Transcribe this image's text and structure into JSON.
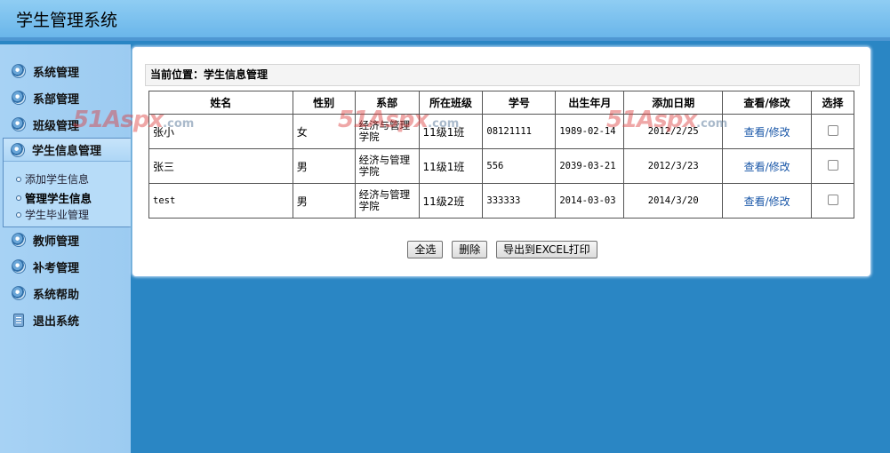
{
  "app": {
    "title": "学生管理系统"
  },
  "sidebar": {
    "items": [
      {
        "label": "系统管理",
        "icon": "disc-icon"
      },
      {
        "label": "系部管理",
        "icon": "disc-icon"
      },
      {
        "label": "班级管理",
        "icon": "disc-icon"
      },
      {
        "label": "学生信息管理",
        "icon": "disc-icon"
      },
      {
        "label": "教师管理",
        "icon": "disc-icon"
      },
      {
        "label": "补考管理",
        "icon": "disc-icon"
      },
      {
        "label": "系统帮助",
        "icon": "disc-icon"
      },
      {
        "label": "退出系统",
        "icon": "phone-icon"
      }
    ],
    "submenu": [
      {
        "label": "添加学生信息"
      },
      {
        "label": "管理学生信息"
      },
      {
        "label": "学生毕业管理"
      }
    ]
  },
  "breadcrumb": {
    "text": "当前位置：学生信息管理"
  },
  "table": {
    "headers": [
      "姓名",
      "性别",
      "系部",
      "所在班级",
      "学号",
      "出生年月",
      "添加日期",
      "查看/修改",
      "选择"
    ],
    "rows": [
      {
        "name": "张小",
        "gender": "女",
        "dept": "经济与管理学院",
        "class": "11级1班",
        "id": "08121111",
        "birth": "1989-02-14",
        "added": "2012/2/25",
        "action": "查看/修改"
      },
      {
        "name": "张三",
        "gender": "男",
        "dept": "经济与管理学院",
        "class": "11级1班",
        "id": "556",
        "birth": "2039-03-21",
        "added": "2012/3/23",
        "action": "查看/修改"
      },
      {
        "name": "test",
        "gender": "男",
        "dept": "经济与管理学院",
        "class": "11级2班",
        "id": "333333",
        "birth": "2014-03-03",
        "added": "2014/3/20",
        "action": "查看/修改"
      }
    ]
  },
  "buttons": {
    "select_all": "全选",
    "delete": "删除",
    "export": "导出到EXCEL打印"
  },
  "watermark": {
    "brand": "51Aspx",
    "domain": ".com"
  }
}
